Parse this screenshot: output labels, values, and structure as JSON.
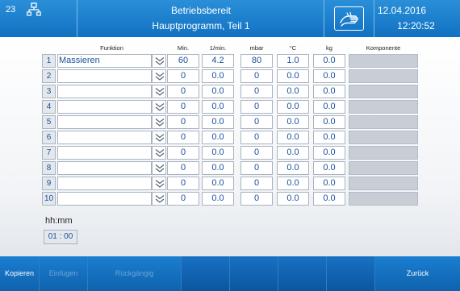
{
  "header": {
    "station_number": "23",
    "status": "Betriebsbereit",
    "subtitle": "Hauptprogramm, Teil 1",
    "date": "12.04.2016",
    "time": "12:20:52"
  },
  "table": {
    "columns": {
      "function": "Funktion",
      "min": "Min.",
      "rate": "1/min.",
      "mbar": "mbar",
      "temp": "°C",
      "kg": "kg",
      "component": "Komponente"
    },
    "rows": [
      {
        "num": "1",
        "function": "Massieren",
        "min": "60",
        "rate": "4.2",
        "mbar": "80",
        "temp": "1.0",
        "kg": "0.0"
      },
      {
        "num": "2",
        "function": "",
        "min": "0",
        "rate": "0.0",
        "mbar": "0",
        "temp": "0.0",
        "kg": "0.0"
      },
      {
        "num": "3",
        "function": "",
        "min": "0",
        "rate": "0.0",
        "mbar": "0",
        "temp": "0.0",
        "kg": "0.0"
      },
      {
        "num": "4",
        "function": "",
        "min": "0",
        "rate": "0.0",
        "mbar": "0",
        "temp": "0.0",
        "kg": "0.0"
      },
      {
        "num": "5",
        "function": "",
        "min": "0",
        "rate": "0.0",
        "mbar": "0",
        "temp": "0.0",
        "kg": "0.0"
      },
      {
        "num": "6",
        "function": "",
        "min": "0",
        "rate": "0.0",
        "mbar": "0",
        "temp": "0.0",
        "kg": "0.0"
      },
      {
        "num": "7",
        "function": "",
        "min": "0",
        "rate": "0.0",
        "mbar": "0",
        "temp": "0.0",
        "kg": "0.0"
      },
      {
        "num": "8",
        "function": "",
        "min": "0",
        "rate": "0.0",
        "mbar": "0",
        "temp": "0.0",
        "kg": "0.0"
      },
      {
        "num": "9",
        "function": "",
        "min": "0",
        "rate": "0.0",
        "mbar": "0",
        "temp": "0.0",
        "kg": "0.0"
      },
      {
        "num": "10",
        "function": "",
        "min": "0",
        "rate": "0.0",
        "mbar": "0",
        "temp": "0.0",
        "kg": "0.0"
      }
    ]
  },
  "duration": {
    "label": "hh:mm",
    "value": "01 : 00"
  },
  "footer": {
    "copy": "Kopieren",
    "paste": "Einfügen",
    "undo": "Rückgängig",
    "back": "Zurück"
  },
  "icons": {
    "network": "network-icon",
    "hand": "hand-touch-icon",
    "dropdown": "chevron-double-down-icon"
  },
  "colors": {
    "header_blue": "#1a7fcf",
    "value_text": "#1a4f9c",
    "disabled_text": "#6aa5d8"
  }
}
